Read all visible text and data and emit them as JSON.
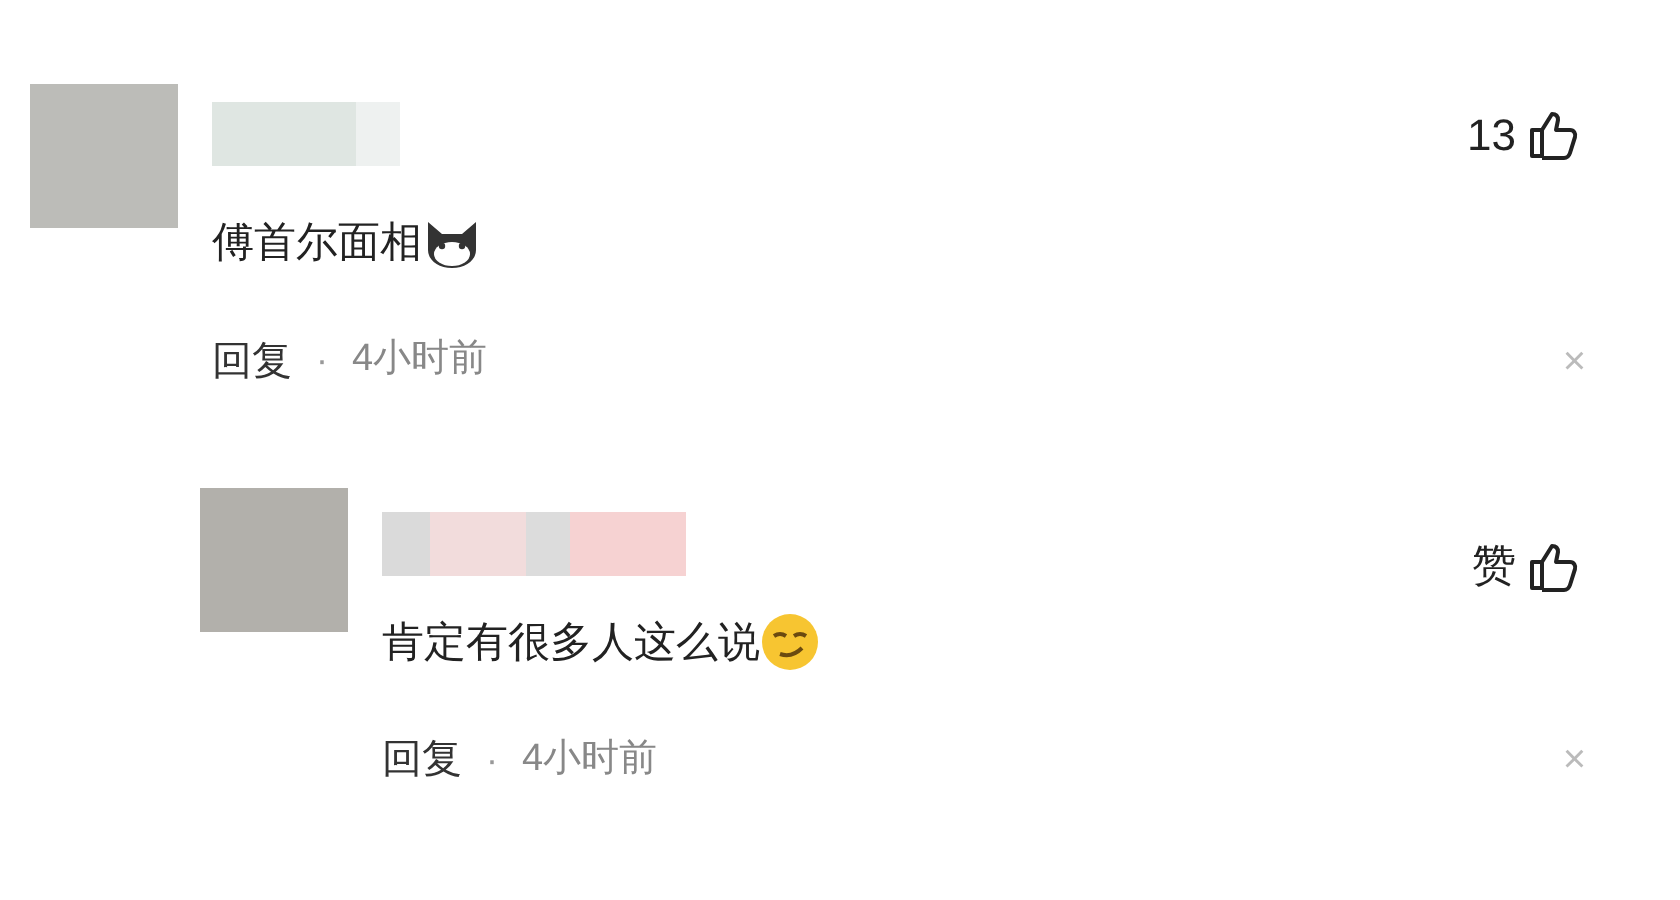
{
  "comments": [
    {
      "likes": "13",
      "text": "傅首尔面相",
      "emoji": {
        "kind": "cat"
      },
      "reply": "回复",
      "separator": "·",
      "time": "4小时前",
      "close": "×",
      "replies": [
        {
          "likes": "赞",
          "text": "肯定有很多人这么说",
          "emoji": {
            "kind": "smirk"
          },
          "reply": "回复",
          "separator": "·",
          "time": "4小时前",
          "close": "×"
        }
      ]
    }
  ]
}
